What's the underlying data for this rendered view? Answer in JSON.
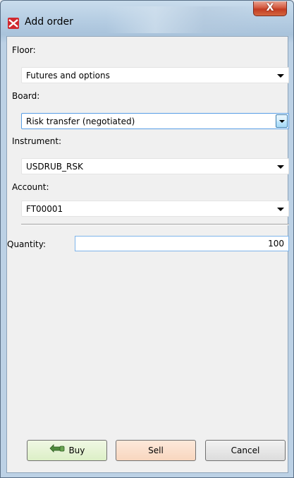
{
  "window": {
    "title": "Add order",
    "close_glyph": "X"
  },
  "form": {
    "floor": {
      "label": "Floor:",
      "value": "Futures and options"
    },
    "board": {
      "label": "Board:",
      "value": "Risk transfer (negotiated)"
    },
    "instrument": {
      "label": "Instrument:",
      "value": "USDRUB_RSK"
    },
    "account": {
      "label": "Account:",
      "value": "FT00001"
    },
    "quantity": {
      "label": "Quantity:",
      "value": "100"
    }
  },
  "buttons": {
    "buy": {
      "label": "Buy",
      "icon": "hand-pointer-icon",
      "color": "#dcefc6"
    },
    "sell": {
      "label": "Sell",
      "color": "#f8d6bf"
    },
    "cancel": {
      "label": "Cancel"
    }
  },
  "colors": {
    "app_icon": "#d0282e",
    "close_button": "#c23b22",
    "focus_border": "#569de5"
  }
}
